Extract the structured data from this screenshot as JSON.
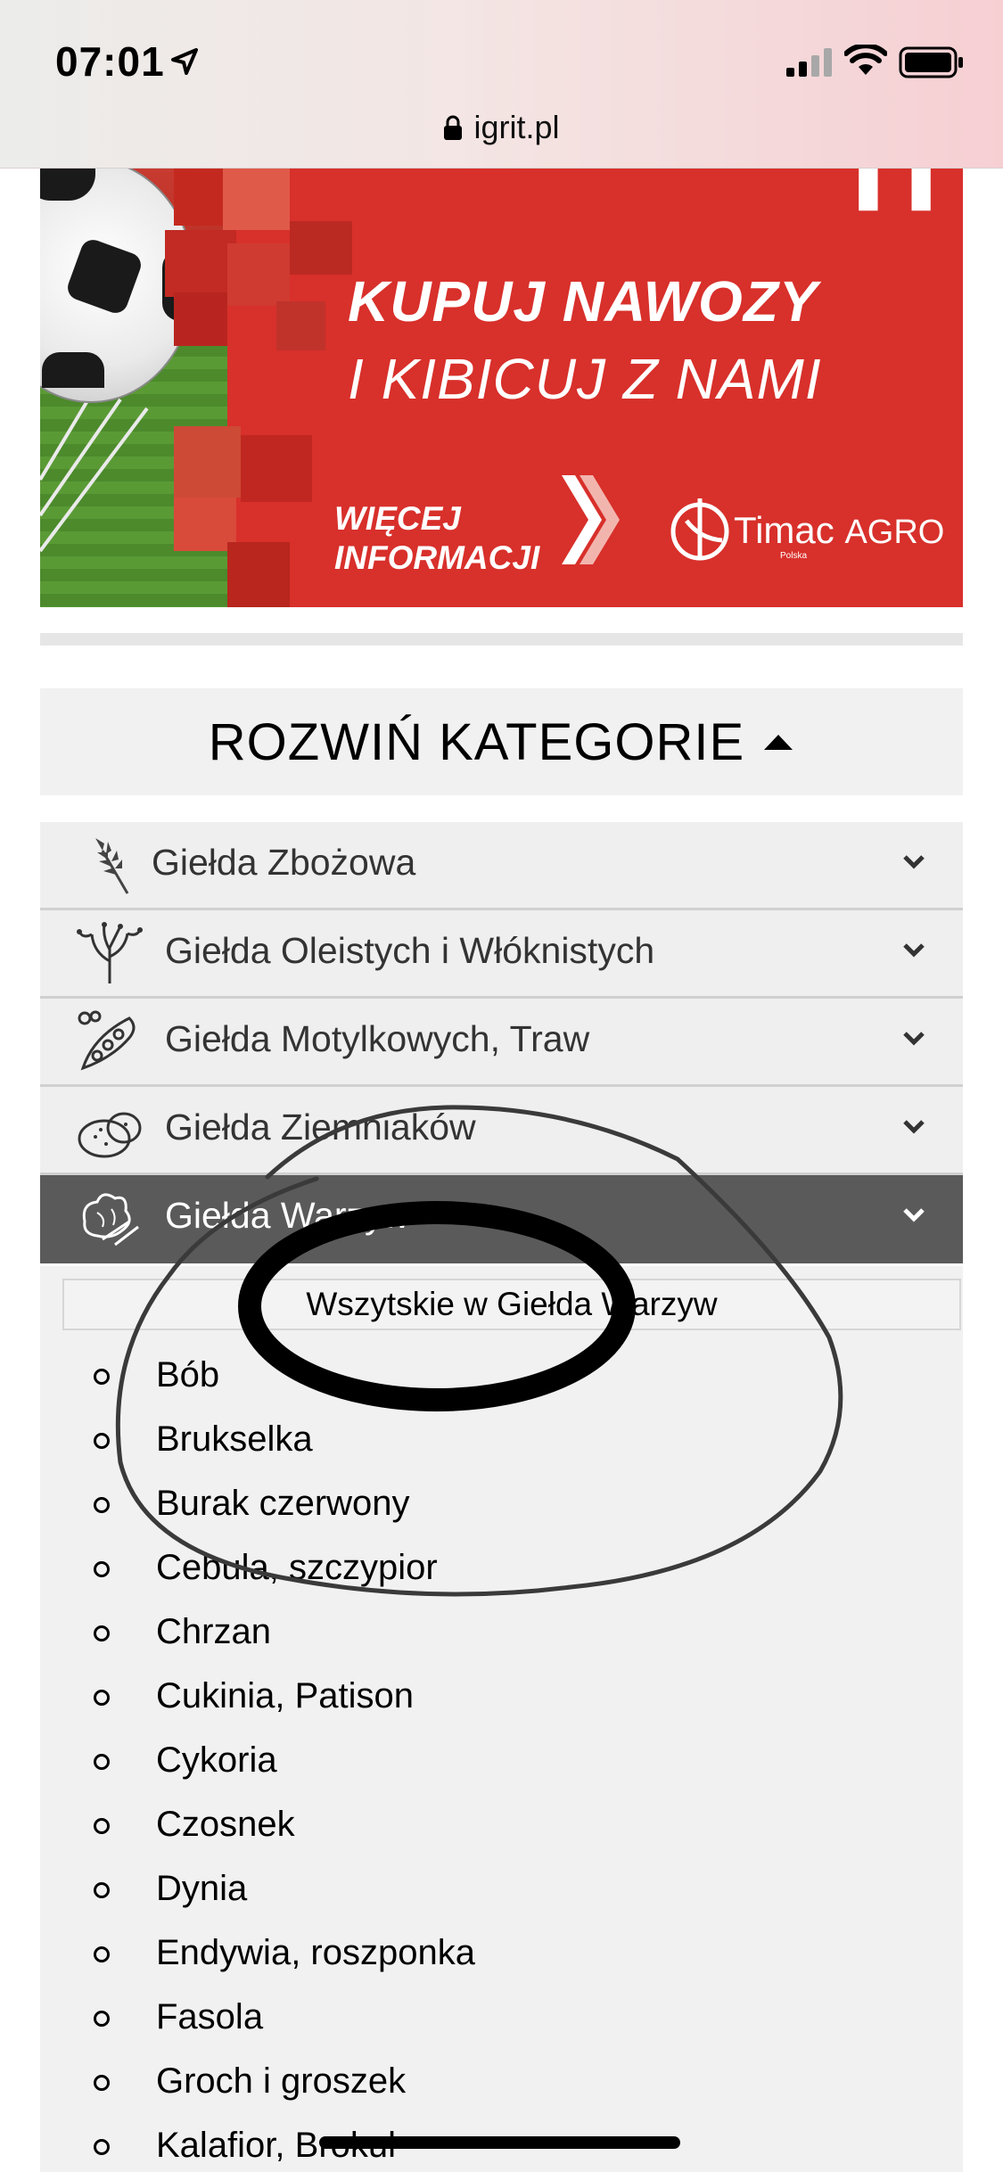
{
  "status_bar": {
    "time": "07:01",
    "icons": [
      "location-arrow-icon",
      "signal-icon",
      "wifi-icon",
      "battery-icon"
    ]
  },
  "browser": {
    "url": "igrit.pl",
    "lock_icon": "lock-icon"
  },
  "banner": {
    "line1": "KUPUJ NAWOZY",
    "line2": "I KIBICUJ Z NAMI",
    "more_line1": "WIĘCEJ",
    "more_line2": "INFORMACJI",
    "brand": "Timac",
    "brand_suffix": "AGRO",
    "brand_sub": "Polska",
    "colors": {
      "background": "#d8302b",
      "grass": "#5a9a35"
    }
  },
  "categories": {
    "toggle_label": "ROZWIŃ KATEGORIE",
    "toggle_icon": "caret-up-icon",
    "items": [
      {
        "label": "Giełda Zbożowa",
        "icon": "wheat-icon"
      },
      {
        "label": "Giełda Oleistych i Włóknistych",
        "icon": "plant-icon"
      },
      {
        "label": "Giełda Motylkowych, Traw",
        "icon": "peas-icon"
      },
      {
        "label": "Giełda Ziemniaków",
        "icon": "potato-icon"
      },
      {
        "label": "Giełda Warzyw",
        "icon": "vegetables-icon",
        "active": true
      }
    ],
    "active_submenu": {
      "all_label": "Wszytskie w Giełda Warzyw",
      "items": [
        "Bób",
        "Brukselka",
        "Burak czerwony",
        "Cebula, szczypior",
        "Chrzan",
        "Cukinia, Patison",
        "Cykoria",
        "Czosnek",
        "Dynia",
        "Endywia, roszponka",
        "Fasola",
        "Groch i groszek",
        "Kalafior, Brokuł"
      ]
    }
  },
  "colors": {
    "active_category_bg": "#5a5a5a",
    "category_bg": "#efefef"
  }
}
